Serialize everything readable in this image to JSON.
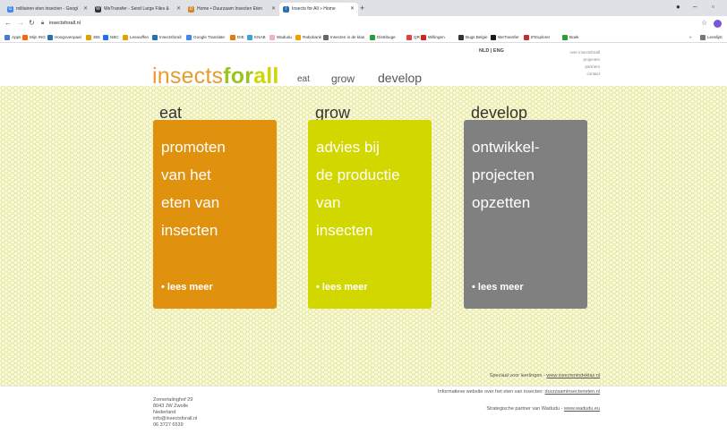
{
  "browser": {
    "tabs": [
      {
        "title": "militairen eten insecten - Googl",
        "favicon": "G",
        "color": "#4285f4"
      },
      {
        "title": "WeTransfer - Send Large Files &",
        "favicon": "W",
        "color": "#333333"
      },
      {
        "title": "Home • Duurzaam Insecten Eten",
        "favicon": "D",
        "color": "#d9822b"
      },
      {
        "title": "Insects for All » Home",
        "favicon": "i",
        "color": "#2a6fb0"
      }
    ],
    "url": "insectsforall.nl",
    "bookmarks": [
      "Apps",
      "Mijn ING",
      "Hoogovenpaal",
      "365",
      "NBC",
      "Leeuwffen",
      "Insectsforall",
      "Google Translate",
      "DIE",
      "KNAB",
      "Wadudu",
      "Rabobank",
      "Insecten in de klas",
      "Distribuge",
      "QR",
      "Willingen",
      "Bugs Belgie",
      "WeTransfer",
      "IFExplorer",
      "Boek"
    ],
    "bookmarks_more": "»",
    "bookmarks_reading": "Leeslijst"
  },
  "site": {
    "logo_part1": "insects",
    "logo_part2": "for",
    "logo_part3": "all",
    "lang_nl": "NLD",
    "lang_sep": "|",
    "lang_en": "ENG",
    "toplinks": [
      "over insectsforall",
      "projecten",
      "partners",
      "contact"
    ],
    "nav": {
      "eat": "eat",
      "grow": "grow",
      "develop": "develop"
    },
    "columns": [
      {
        "title": "eat",
        "lines": [
          "promoten",
          "van het",
          "eten van",
          "insecten"
        ],
        "more": "• lees meer",
        "color": "#e0920f"
      },
      {
        "title": "grow",
        "lines": [
          "advies bij",
          "de productie",
          "van",
          "insecten"
        ],
        "more": "• lees meer",
        "color": "#d3d700"
      },
      {
        "title": "develop",
        "lines": [
          "ontwikkel-",
          "projecten",
          "opzetten"
        ],
        "more": "• lees meer",
        "color": "#808080"
      }
    ],
    "footer": {
      "address": [
        "Zomertalinghof 29",
        "8043 JW Zwolle",
        "Nederland",
        "info@insectsforall.nl",
        "06 3727 6539"
      ],
      "links": [
        {
          "text": "Speciaal voor leerlingen - ",
          "link": "www.insectenindeklas.nl"
        },
        {
          "text": "Informatieve website over het eten van insecten: ",
          "link": "duurzaaminsecteneten.nl"
        },
        {
          "text": "Strategische partner van Wadudu - ",
          "link": "www.wadudu.eu"
        }
      ]
    }
  }
}
